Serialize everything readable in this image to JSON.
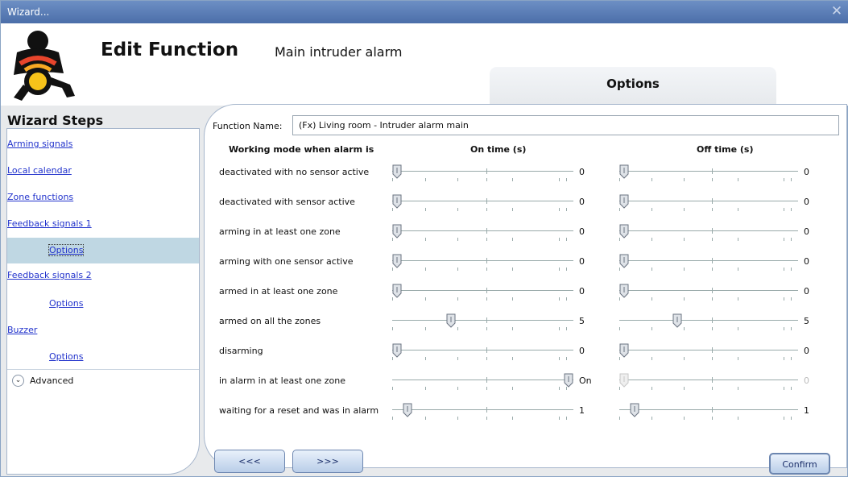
{
  "window": {
    "title": "Wizard...",
    "close_label": "✕"
  },
  "header": {
    "title": "Edit Function",
    "subtitle": "Main intruder alarm",
    "tab_label": "Options"
  },
  "sidebar": {
    "heading": "Wizard Steps",
    "items": [
      {
        "label": "Arming signals",
        "level": 0
      },
      {
        "label": "Local calendar",
        "level": 0
      },
      {
        "label": "Zone functions",
        "level": 0
      },
      {
        "label": "Feedback signals 1",
        "level": 0
      },
      {
        "label": "Options",
        "level": 1,
        "selected": true
      },
      {
        "label": "Feedback signals 2",
        "level": 0
      },
      {
        "label": "Options",
        "level": 1
      },
      {
        "label": "Buzzer",
        "level": 0
      },
      {
        "label": "Options",
        "level": 1
      }
    ],
    "advanced_label": "Advanced"
  },
  "form": {
    "function_name_label": "Function Name:",
    "function_name_value": "(Fx) Living room - Intruder alarm main",
    "col_mode": "Working mode when alarm is",
    "col_on": "On time (s)",
    "col_off": "Off time (s)",
    "rows": [
      {
        "label": "deactivated with no sensor active",
        "on_value": "0",
        "off_value": "0",
        "on_level": 0,
        "off_level": 0
      },
      {
        "label": "deactivated with sensor active",
        "on_value": "0",
        "off_value": "0",
        "on_level": 0,
        "off_level": 0
      },
      {
        "label": "arming in at least one zone",
        "on_value": "0",
        "off_value": "0",
        "on_level": 0,
        "off_level": 0
      },
      {
        "label": "arming with one sensor active",
        "on_value": "0",
        "off_value": "0",
        "on_level": 0,
        "off_level": 0
      },
      {
        "label": "armed in at least one zone",
        "on_value": "0",
        "off_value": "0",
        "on_level": 0,
        "off_level": 0
      },
      {
        "label": "armed on all the zones",
        "on_value": "5",
        "off_value": "5",
        "on_level": 5,
        "off_level": 5
      },
      {
        "label": "disarming",
        "on_value": "0",
        "off_value": "0",
        "on_level": 0,
        "off_level": 0
      },
      {
        "label": "in alarm in at least one zone",
        "on_value": "On",
        "off_value": "0",
        "on_level": 16,
        "off_level": 0,
        "off_disabled": true
      },
      {
        "label": "waiting for a reset and was in alarm",
        "on_value": "1",
        "off_value": "1",
        "on_level": 1,
        "off_level": 1
      }
    ]
  },
  "footer": {
    "prev_label": "<<<",
    "next_label": ">>>",
    "confirm_label": "Confirm"
  }
}
